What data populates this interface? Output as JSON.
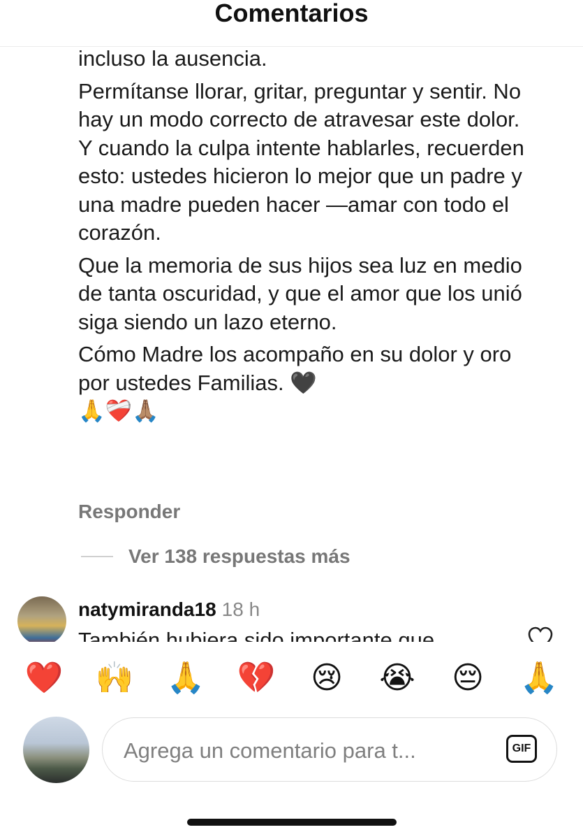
{
  "header": {
    "title": "Comentarios"
  },
  "comment": {
    "paragraphs": [
      "incluso la ausencia.",
      "Permítanse llorar, gritar, preguntar y sentir. No hay un modo correcto de atravesar este dolor. Y cuando la culpa intente hablarles, recuerden esto: ustedes hicieron lo mejor que un padre y una madre pueden hacer —amar con todo el corazón.",
      "Que la memoria de sus hijos sea luz en medio de tanta oscuridad, y que el amor que los unió siga siendo un lazo eterno.",
      "Cómo Madre los acompaño en su dolor y oro por ustedes Familias. 🖤"
    ],
    "emoji_line": "🙏❤️‍🩹🙏🏽",
    "reply_label": "Responder",
    "more_replies_label": "Ver 138 respuestas más"
  },
  "next_comment": {
    "username": "natymiranda18",
    "time": "18 h",
    "text_partial": "También hubiera sido importante que"
  },
  "quick_emojis": [
    "❤️",
    "🙌",
    "🙏",
    "💔",
    "😢",
    "😭",
    "😔",
    "🙏"
  ],
  "composer": {
    "placeholder": "Agrega un comentario para t...",
    "gif_label": "GIF"
  },
  "icons": {
    "like": "heart-outline-icon"
  }
}
